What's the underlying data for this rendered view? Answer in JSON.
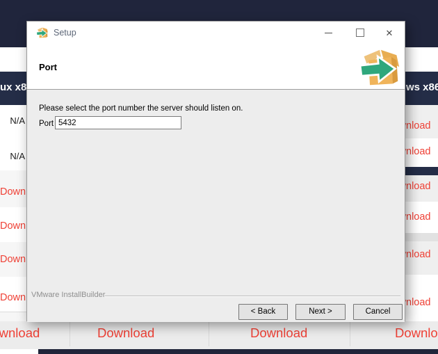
{
  "colors": {
    "accent_red": "#ef4136",
    "navy_table_header": "#242d47",
    "navy_top_band": "#20253c",
    "dialog_body_gray": "#ededed"
  },
  "icons": {
    "window_icon": "installbuilder-box-arrow-icon",
    "header_logo": "installbuilder-box-arrow-logo",
    "minimize": "minimize-icon",
    "maximize": "maximize-icon",
    "close": "close-icon"
  },
  "dialog": {
    "title": "Setup",
    "heading": "Port",
    "instruction": "Please select the port number the server should listen on.",
    "port_label": "Port",
    "port_value": "5432",
    "brand": "VMware InstallBuilder",
    "buttons": {
      "back": "< Back",
      "next": "Next >",
      "cancel": "Cancel"
    }
  },
  "background": {
    "header_left_partial": "ux x8",
    "header_right_partial": "ws x86",
    "left_column": [
      "N/A",
      "N/A",
      "Download",
      "Download",
      "Download",
      "Download"
    ],
    "right_column": [
      "Download",
      "Download",
      "Download",
      "Download",
      "Download",
      "Download"
    ],
    "bottom_row": [
      "Download",
      "Download",
      "Download",
      "Download"
    ]
  }
}
